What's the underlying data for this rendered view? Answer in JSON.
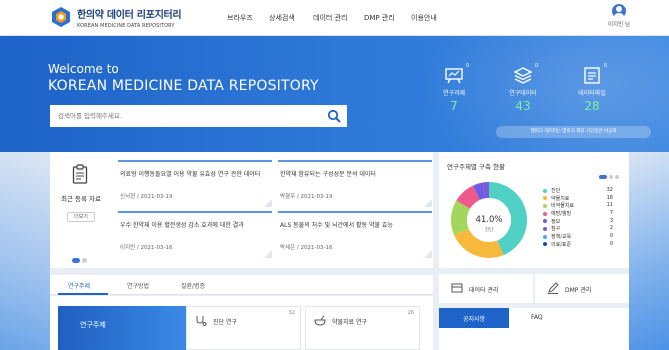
{
  "header": {
    "logo_kr": "한의약 데이터 리포지터리",
    "logo_en": "KOREAN MEDICINE DATA REPOSITORY",
    "nav": [
      "브라우즈",
      "상세검색",
      "데이터 관리",
      "DMP 관리",
      "이용안내"
    ],
    "user_name": "이지민 님"
  },
  "hero": {
    "welcome": "Welcome to",
    "title": "KOREAN MEDICINE DATA REPOSITORY",
    "search_placeholder": "검색어를 입력해주세요.",
    "stats": [
      {
        "label": "연구과제",
        "value": "7",
        "badge": "0",
        "icon": "project-board-icon"
      },
      {
        "label": "연구데이터",
        "value": "43",
        "badge": "0",
        "icon": "data-stack-icon"
      },
      {
        "label": "데이터파일",
        "value": "28",
        "badge": "0",
        "icon": "data-file-icon"
      }
    ],
    "notice": "엠버고 데이터는 엠바고 해당 기간동안 비공개"
  },
  "recent": {
    "title": "최근 등록 자료",
    "more": "더보기",
    "posts": [
      {
        "title": "의료형 이행동돌요열 이용 약물 유효성 연구 관한 데이터",
        "meta": "신서현 / 2021-03-19"
      },
      {
        "title": "한약재 함유되는 구성성분 분석 데이터",
        "meta": "박형우 / 2021-03-19"
      },
      {
        "title": "우수 한약재 이용 혈전생성 감소 효과에 대한 결과",
        "meta": "이지민 / 2021-03-16"
      },
      {
        "title": "ALS 동물의 처수 및 뇌간에서 활동 약물 효능",
        "meta": "박세은 / 2021-03-16"
      }
    ]
  },
  "chart_card": {
    "title": "연구주제별 구축 현황",
    "center_value": "41.0%",
    "center_label": "진단"
  },
  "chart_data": {
    "type": "pie",
    "title": "연구주제별 구축 현황",
    "categories": [
      "진단",
      "약물치료",
      "비약물치료",
      "예방/웰빙",
      "정보",
      "침구",
      "정책/교육",
      "의료/표준"
    ],
    "values": [
      32,
      18,
      11,
      7,
      3,
      2,
      0,
      0
    ],
    "colors": [
      "#4fd1c5",
      "#f6b93b",
      "#a3d65c",
      "#f05a8a",
      "#6c5ce7",
      "#7a5bd6",
      "#45aaf2",
      "#1f4e9c"
    ],
    "center_label": "41.0%"
  },
  "tabs": {
    "items": [
      "연구주제",
      "연구방법",
      "질환/병증"
    ],
    "active": 0
  },
  "panel": {
    "banner": "연구주제",
    "cats": [
      {
        "label": "진단 연구",
        "num": "32",
        "icon": "stethoscope-icon"
      },
      {
        "label": "약물치료 연구",
        "num": "26",
        "icon": "medicine-bowl-icon"
      }
    ]
  },
  "quick": [
    {
      "label": "데이터 관리",
      "icon": "data-manage-icon"
    },
    {
      "label": "DMP 관리",
      "icon": "edit-icon"
    }
  ],
  "notice_tabs": [
    "공지사항",
    "FAQ"
  ]
}
